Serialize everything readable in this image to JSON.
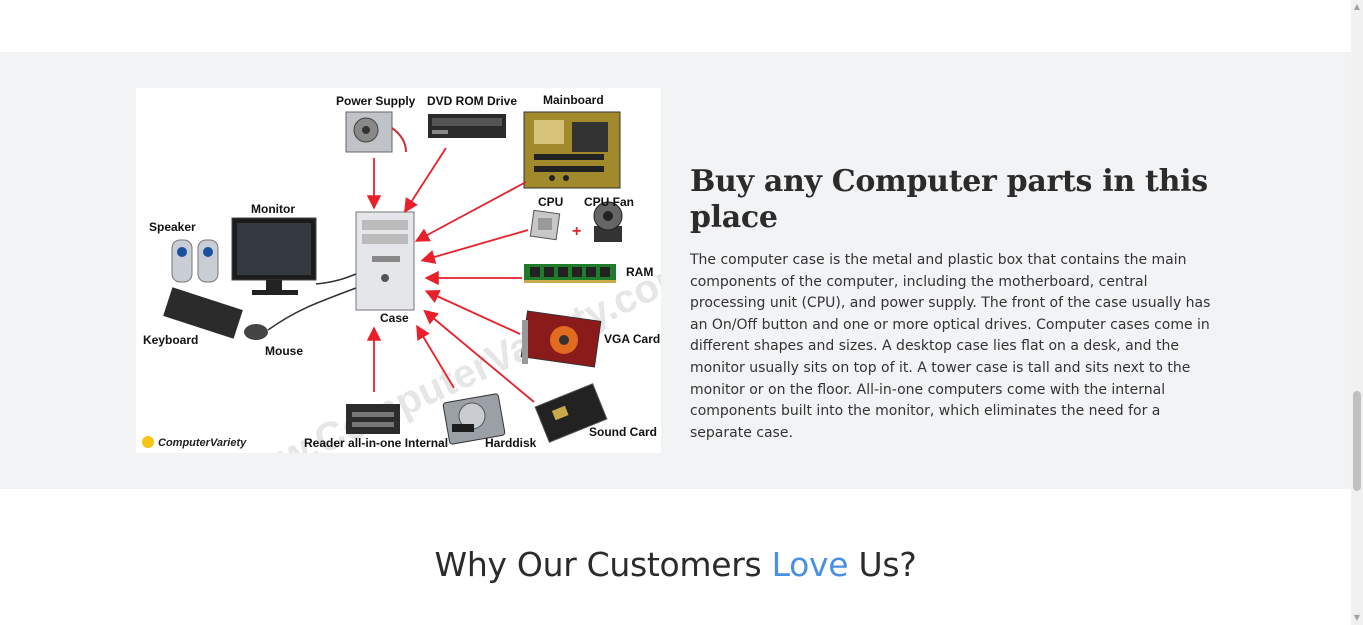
{
  "parts_section": {
    "heading": "Buy any Computer parts in this place",
    "paragraph": "The computer case is the metal and plastic box that contains the main components of the computer, including the motherboard, central processing unit (CPU), and power supply. The front of the case usually has an On/Off button and one or more optical drives. Computer cases come in different shapes and sizes. A desktop case lies flat on a desk, and the monitor usually sits on top of it. A tower case is tall and sits next to the monitor or on the floor. All-in-one computers come with the internal components built into the monitor, which eliminates the need for a separate case.",
    "diagram": {
      "labels": {
        "power_supply": "Power Supply",
        "dvd_rom": "DVD ROM Drive",
        "mainboard": "Mainboard",
        "cpu": "CPU",
        "cpu_fan": "CPU Fan",
        "ram": "RAM",
        "vga": "VGA Card",
        "sound": "Sound Card",
        "harddisk": "Harddisk",
        "reader": "Reader all-in-one Internal",
        "case": "Case",
        "monitor": "Monitor",
        "speaker": "Speaker",
        "keyboard": "Keyboard",
        "mouse": "Mouse",
        "plus": "+",
        "logo": "ComputerVariety",
        "watermark": "www.ComputerVariety.com"
      }
    }
  },
  "reviews": {
    "title_before": "Why Our Customers ",
    "title_accent": "Love",
    "title_after": " Us?"
  },
  "colors": {
    "section_bg": "#f2f3f5",
    "accent": "#4a90e2",
    "arrow": "#e8202a"
  },
  "icons": {
    "scroll_up": "triangle-up-icon",
    "scroll_down": "triangle-down-icon"
  }
}
